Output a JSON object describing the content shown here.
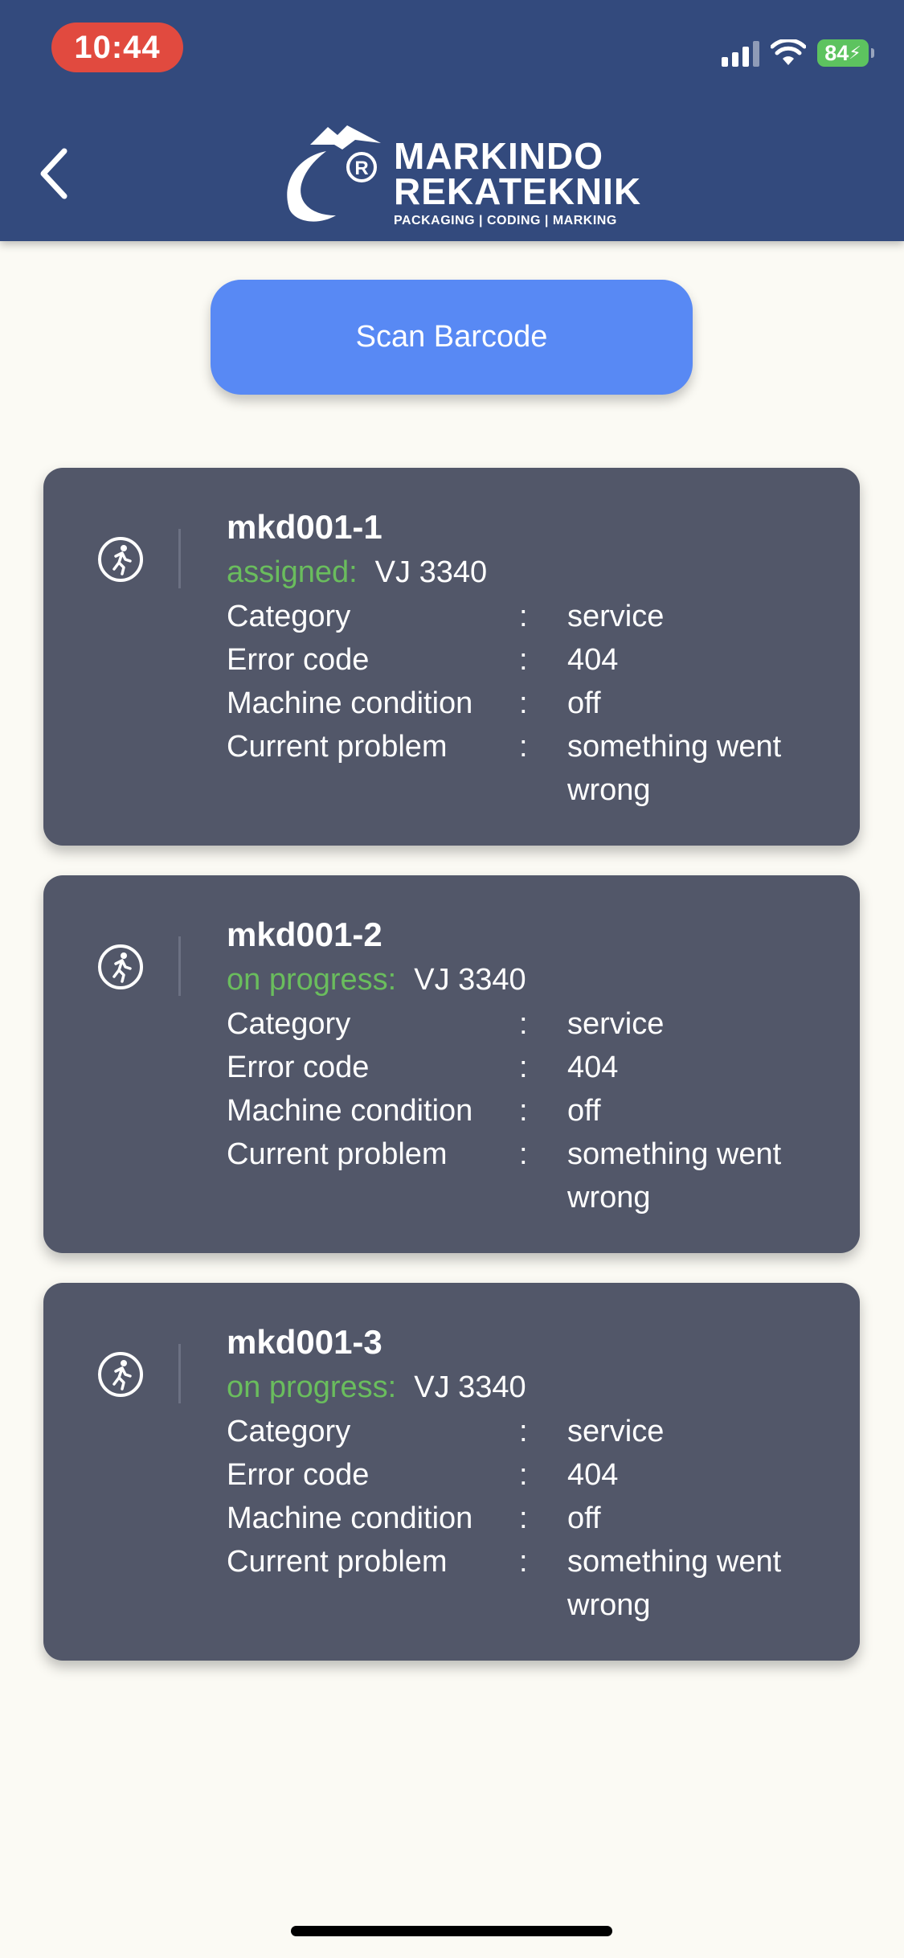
{
  "status_bar": {
    "time": "10:44",
    "battery": "84",
    "icons": [
      "signal-icon",
      "wifi-icon",
      "battery-icon"
    ]
  },
  "header": {
    "back_icon": "chevron-left-icon",
    "logo": {
      "line1": "MARKINDO",
      "line2": "REKATEKNIK",
      "tagline": "PACKAGING | CODING | MARKING",
      "registered": "®"
    }
  },
  "scan_button": {
    "label": "Scan Barcode"
  },
  "colors": {
    "header_bg": "#334a7d",
    "card_bg": "#525769",
    "button_bg": "#5889f4",
    "status_green": "#6abd5d",
    "time_pill": "#e14a3f"
  },
  "tickets": [
    {
      "id": "mkd001-1",
      "status": "assigned:",
      "machine": "VJ 3340",
      "icon": "running-person-icon",
      "fields": [
        {
          "label": "Category",
          "sep": ":",
          "value": "service"
        },
        {
          "label": "Error code",
          "sep": ":",
          "value": "404"
        },
        {
          "label": "Machine condition",
          "sep": ":",
          "value": "off"
        },
        {
          "label": "Current problem",
          "sep": ":",
          "value": "something went wrong"
        }
      ]
    },
    {
      "id": "mkd001-2",
      "status": "on progress:",
      "machine": "VJ 3340",
      "icon": "running-person-icon",
      "fields": [
        {
          "label": "Category",
          "sep": ":",
          "value": "service"
        },
        {
          "label": "Error code",
          "sep": ":",
          "value": "404"
        },
        {
          "label": "Machine condition",
          "sep": ":",
          "value": "off"
        },
        {
          "label": "Current problem",
          "sep": ":",
          "value": "something went wrong"
        }
      ]
    },
    {
      "id": "mkd001-3",
      "status": "on progress:",
      "machine": "VJ 3340",
      "icon": "running-person-icon",
      "fields": [
        {
          "label": "Category",
          "sep": ":",
          "value": "service"
        },
        {
          "label": "Error code",
          "sep": ":",
          "value": "404"
        },
        {
          "label": "Machine condition",
          "sep": ":",
          "value": "off"
        },
        {
          "label": "Current problem",
          "sep": ":",
          "value": "something went wrong"
        }
      ]
    }
  ]
}
